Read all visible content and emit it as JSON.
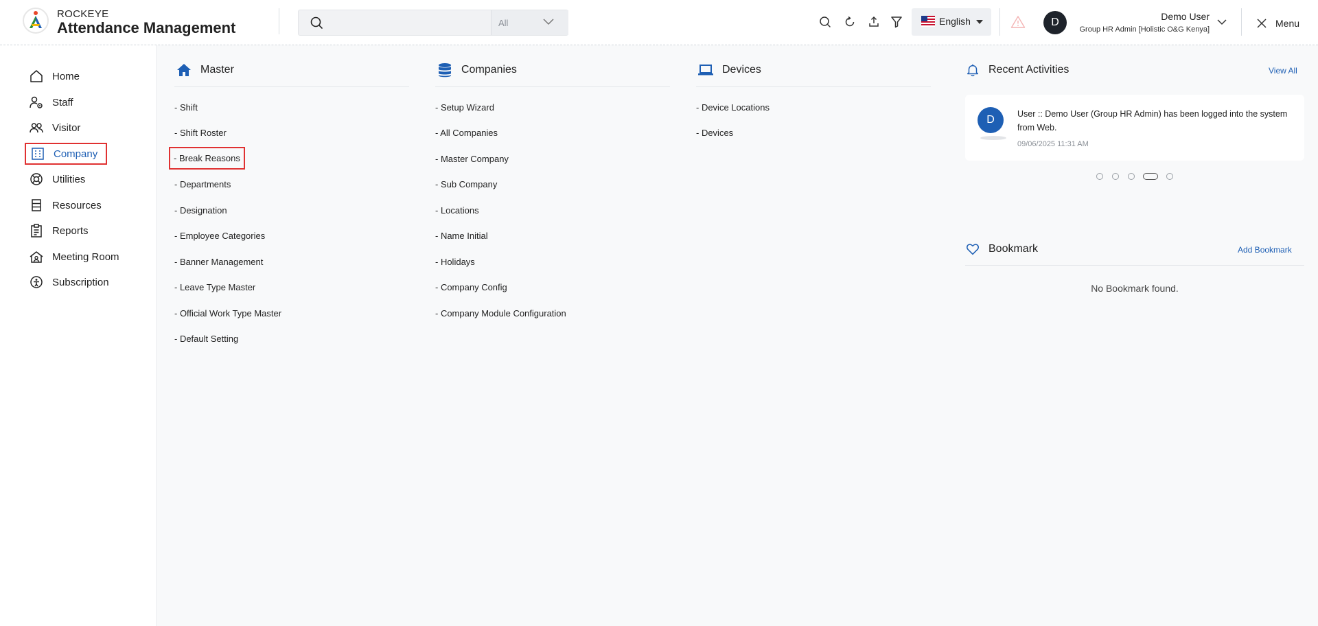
{
  "header": {
    "brand_top": "ROCKEYE",
    "brand_main": "Attendance Management",
    "search": {
      "placeholder": "",
      "value": "",
      "filter": "All"
    },
    "language": "English",
    "user_initial": "D",
    "user_name": "Demo User",
    "user_role": "Group HR Admin [Holistic O&G Kenya]",
    "menu_label": "Menu"
  },
  "sidebar": {
    "items": [
      {
        "label": "Home",
        "icon": "home-icon"
      },
      {
        "label": "Staff",
        "icon": "staff-icon"
      },
      {
        "label": "Visitor",
        "icon": "visitor-icon"
      },
      {
        "label": "Company",
        "icon": "company-icon",
        "active": true
      },
      {
        "label": "Utilities",
        "icon": "utilities-icon"
      },
      {
        "label": "Resources",
        "icon": "resources-icon"
      },
      {
        "label": "Reports",
        "icon": "reports-icon"
      },
      {
        "label": "Meeting Room",
        "icon": "meeting-room-icon"
      },
      {
        "label": "Subscription",
        "icon": "subscription-icon"
      }
    ]
  },
  "master": {
    "title": "Master",
    "links": [
      "- Shift",
      "- Shift Roster",
      "- Break Reasons",
      "- Departments",
      "- Designation",
      "- Employee Categories",
      "- Banner Management",
      "- Leave Type Master",
      "- Official Work Type Master",
      "- Default Setting"
    ],
    "active_link": "- Break Reasons"
  },
  "companies": {
    "title": "Companies",
    "links": [
      "- Setup Wizard",
      "- All Companies",
      "- Master Company",
      "- Sub Company",
      "- Locations",
      "- Name Initial",
      "- Holidays",
      "- Company Config",
      "- Company Module Configuration"
    ]
  },
  "devices": {
    "title": "Devices",
    "links": [
      "- Device Locations",
      "- Devices"
    ]
  },
  "recent_activities": {
    "title": "Recent Activities",
    "view_all": "View All",
    "item": {
      "initial": "D",
      "text": "User :: Demo User (Group HR Admin) has been logged into the system from Web.",
      "time": "09/06/2025 11:31 AM"
    },
    "pager_count": 5,
    "pager_active": 3
  },
  "bookmark": {
    "title": "Bookmark",
    "add": "Add Bookmark",
    "empty": "No Bookmark found."
  },
  "colors": {
    "accent": "#1e5fb4",
    "highlight": "#e03131"
  }
}
